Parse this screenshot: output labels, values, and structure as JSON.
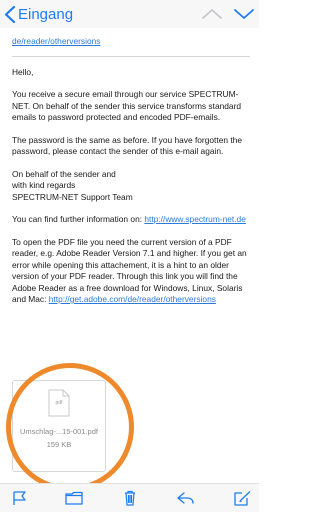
{
  "nav": {
    "back_label": "Eingang",
    "accent": "#1e7cf2"
  },
  "email": {
    "link_top": "de/reader/otherversions",
    "greeting": "Hello,",
    "para1": "You receive a secure email through our service SPECTRUM-NET. On behalf of the sender this service transforms standard emails to password protected and encoded PDF-emails.",
    "para2": "The password is the same as before. If you have forgotten the password, please contact the sender of this e-mail again.",
    "signoff_line1": "On behalf of the sender and",
    "signoff_line2": "with kind regards",
    "signoff_line3": "SPECTRUM-NET Support Team",
    "info_text": "You can find further information on: ",
    "info_link": "http://www.spectrum-net.de",
    "para3_text": "To open the PDF file you need the current version of a PDF reader, e.g. Adobe Reader Version 7.1 and higher. If you get an error while opening this attachement, it is a hint to an older version of your PDF reader. Through this link you will find the Adobe Reader as a free download for Windows, Linux, Solaris and Mac: ",
    "para3_link": "http://get.adobe.com/de/reader/otherversions"
  },
  "attachment": {
    "icon_label": "pdf",
    "filename": "Umschlag-...15-001.pdf",
    "size": "159 KB",
    "highlight_color": "#ee8a2c"
  },
  "toolbar": {
    "icons": [
      "flag-icon",
      "folder-icon",
      "trash-icon",
      "reply-icon",
      "compose-icon"
    ]
  }
}
